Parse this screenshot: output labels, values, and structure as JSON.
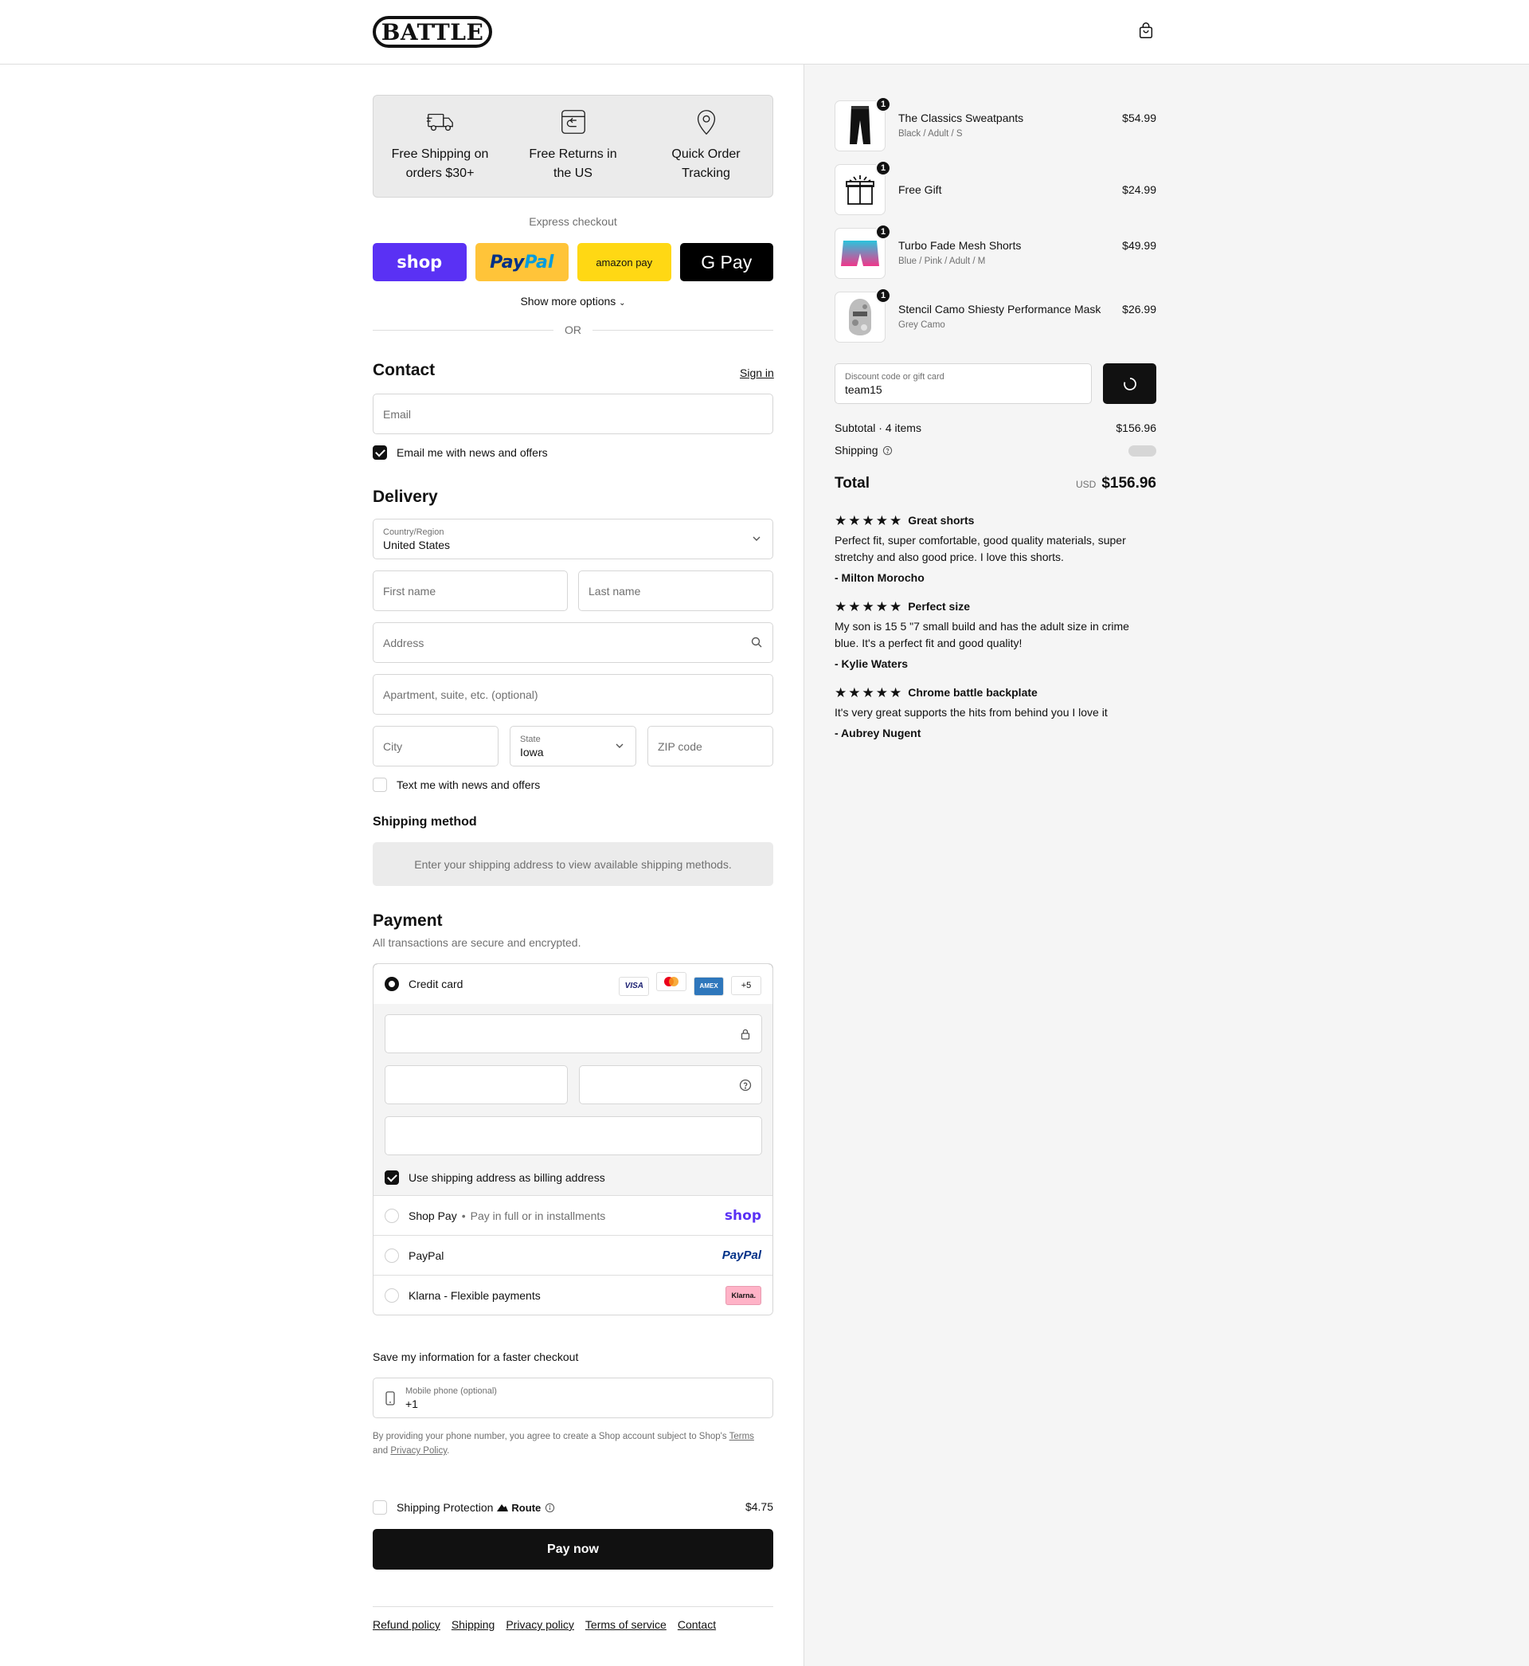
{
  "header": {
    "logo_text": "BATTLE",
    "cart_icon": "shopping-bag-icon"
  },
  "features": [
    {
      "icon": "truck-icon",
      "line1": "Free Shipping on",
      "line2": "orders $30+"
    },
    {
      "icon": "return-box-icon",
      "line1": "Free Returns in",
      "line2": "the US"
    },
    {
      "icon": "location-pin-icon",
      "line1": "Quick Order",
      "line2": "Tracking"
    }
  ],
  "express": {
    "label": "Express checkout",
    "shop": "shop",
    "paypal_a": "Pay",
    "paypal_b": "Pal",
    "amazon": "amazon pay",
    "gpay": "G Pay",
    "more_options": "Show more options",
    "or": "OR"
  },
  "contact": {
    "title": "Contact",
    "sign_in": "Sign in",
    "email_placeholder": "Email",
    "news_label": "Email me with news and offers"
  },
  "delivery": {
    "title": "Delivery",
    "country_label": "Country/Region",
    "country_value": "United States",
    "first_name": "First name",
    "last_name": "Last name",
    "address": "Address",
    "apartment": "Apartment, suite, etc. (optional)",
    "city": "City",
    "state_label": "State",
    "state_value": "Iowa",
    "zip": "ZIP code",
    "text_label": "Text me with news and offers"
  },
  "shipping_method": {
    "title": "Shipping method",
    "notice": "Enter your shipping address to view available shipping methods."
  },
  "payment": {
    "title": "Payment",
    "subtitle": "All transactions are secure and encrypted.",
    "credit_card": "Credit card",
    "cards": [
      "VISA",
      "MC",
      "AMEX",
      "+5"
    ],
    "billing_label": "Use shipping address as billing address",
    "shop_pay": "Shop Pay",
    "shop_pay_sub": "Pay in full or in installments",
    "shop_logo": "shop",
    "paypal": "PayPal",
    "paypal_logo": "PayPal",
    "klarna": "Klarna - Flexible payments",
    "klarna_logo": "Klarna."
  },
  "save_info": {
    "title": "Save my information for a faster checkout",
    "phone_label": "Mobile phone (optional)",
    "phone_value": "+1",
    "disclaimer_a": "By providing your phone number, you agree to create a Shop account subject to Shop's ",
    "terms": "Terms",
    "disclaimer_b": "and ",
    "privacy": "Privacy Policy",
    "disclaimer_c": "."
  },
  "protection": {
    "label": "Shipping Protection",
    "brand": "Route",
    "price": "$4.75"
  },
  "pay_now": "Pay now",
  "footer": [
    "Refund policy",
    "Shipping",
    "Privacy policy",
    "Terms of service",
    "Contact"
  ],
  "order": {
    "items": [
      {
        "qty": "1",
        "name": "The Classics Sweatpants",
        "variant": "Black / Adult / S",
        "price": "$54.99"
      },
      {
        "qty": "1",
        "name": "Free Gift",
        "variant": "",
        "price": "$24.99"
      },
      {
        "qty": "1",
        "name": "Turbo Fade Mesh Shorts",
        "variant": "Blue / Pink / Adult / M",
        "price": "$49.99"
      },
      {
        "qty": "1",
        "name": "Stencil Camo Shiesty Performance Mask",
        "variant": "Grey Camo",
        "price": "$26.99"
      }
    ],
    "discount_label": "Discount code or gift card",
    "discount_value": "team15",
    "subtotal_label": "Subtotal · 4 items",
    "subtotal": "$156.96",
    "shipping_label": "Shipping",
    "total_label": "Total",
    "currency": "USD",
    "total": "$156.96"
  },
  "reviews": [
    {
      "stars": "★★★★★",
      "title": "Great shorts",
      "body": "Perfect fit, super comfortable, good quality materials, super stretchy and also good price. I love this shorts.",
      "author": "- Milton Morocho"
    },
    {
      "stars": "★★★★★",
      "title": "Perfect size",
      "body": "My son is 15 5 \"7 small build and has the adult size in crime blue. It's a perfect fit and good quality!",
      "author": "- Kylie Waters"
    },
    {
      "stars": "★★★★★",
      "title": "Chrome battle backplate",
      "body": "It's very great supports the hits from behind you I love it",
      "author": "- Aubrey Nugent"
    }
  ]
}
